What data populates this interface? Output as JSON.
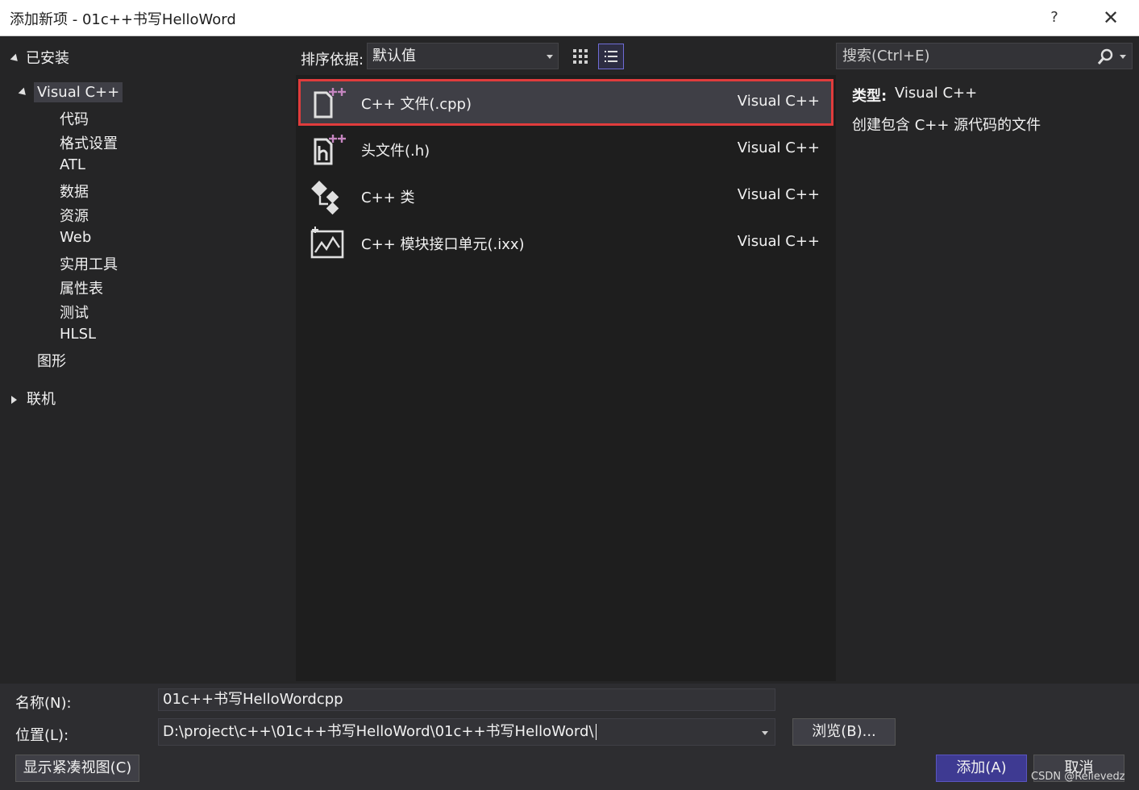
{
  "window": {
    "title": "添加新项 - 01c++书写HelloWord",
    "help": "?",
    "close": "✕"
  },
  "tree": {
    "installed": "已安装",
    "visual_cpp": "Visual C++",
    "children": [
      "代码",
      "格式设置",
      "ATL",
      "数据",
      "资源",
      "Web",
      "实用工具",
      "属性表",
      "测试",
      "HLSL"
    ],
    "graphics": "图形",
    "online": "联机"
  },
  "toolbar": {
    "sort_label": "排序依据:",
    "sort_value": "默认值"
  },
  "search": {
    "placeholder": "搜索(Ctrl+E)"
  },
  "items": [
    {
      "name": "C++ 文件(.cpp)",
      "lang": "Visual C++",
      "icon": "cpp-file-icon",
      "selected": true
    },
    {
      "name": "头文件(.h)",
      "lang": "Visual C++",
      "icon": "header-file-icon",
      "selected": false
    },
    {
      "name": "C++ 类",
      "lang": "Visual C++",
      "icon": "cpp-class-icon",
      "selected": false
    },
    {
      "name": "C++ 模块接口单元(.ixx)",
      "lang": "Visual C++",
      "icon": "module-interface-icon",
      "selected": false
    }
  ],
  "details": {
    "type_label": "类型:",
    "type_value": "Visual C++",
    "description": "创建包含 C++ 源代码的文件"
  },
  "form": {
    "name_label": "名称(N):",
    "name_value": "01c++书写HelloWordcpp",
    "location_label": "位置(L):",
    "location_value": "D:\\project\\c++\\01c++书写HelloWord\\01c++书写HelloWord\\",
    "browse": "浏览(B)...",
    "compact_view": "显示紧凑视图(C)",
    "add": "添加(A)",
    "cancel": "取消"
  },
  "watermark": "CSDN @Relievedz",
  "colors": {
    "accent": "#6f6cd6",
    "selection_outline": "#e03c3c",
    "add_button": "#3e3a92",
    "plus_marks": "#c586c0"
  }
}
